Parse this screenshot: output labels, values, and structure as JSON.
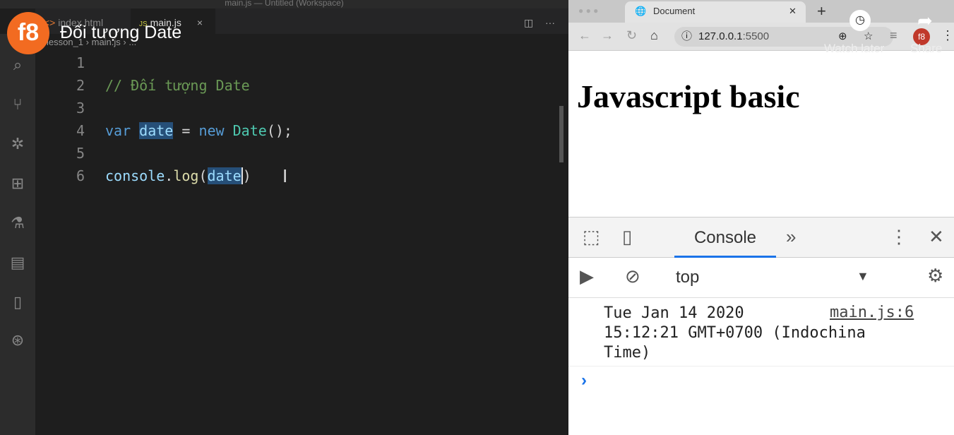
{
  "editor": {
    "window_title": "main.js — Untitled (Workspace)",
    "tabs": [
      {
        "label": "index.html",
        "icon": "<>"
      },
      {
        "label": "main.js",
        "icon": "JS"
      }
    ],
    "breadcrumb": [
      "lesson_1",
      "main.js",
      "..."
    ],
    "lines": [
      "1",
      "2",
      "3",
      "4",
      "5",
      "6"
    ],
    "code": {
      "l2": "// Đối tượng Date",
      "l4_var": "var",
      "l4_name": "date",
      "l4_eq": " = ",
      "l4_new": "new",
      "l4_cls": "Date",
      "l4_end": "();",
      "l6_obj": "console",
      "l6_dot": ".",
      "l6_fn": "log",
      "l6_open": "(",
      "l6_arg": "date",
      "l6_close": ")"
    }
  },
  "overlay": {
    "logo": "f8",
    "video_title": "Đối tượng Date",
    "watch_later": "Watch later",
    "share": "Share"
  },
  "browser": {
    "tab_title": "Document",
    "url_host": "127.0.0.1",
    "url_port": ":5500",
    "page_heading": "Javascript basic",
    "devtools": {
      "active_tab": "Console",
      "context": "top",
      "log_text": "Tue Jan 14 2020\n15:12:21 GMT+0700 (Indochina\nTime)",
      "log_source": "main.js:6",
      "prompt": "›"
    }
  }
}
